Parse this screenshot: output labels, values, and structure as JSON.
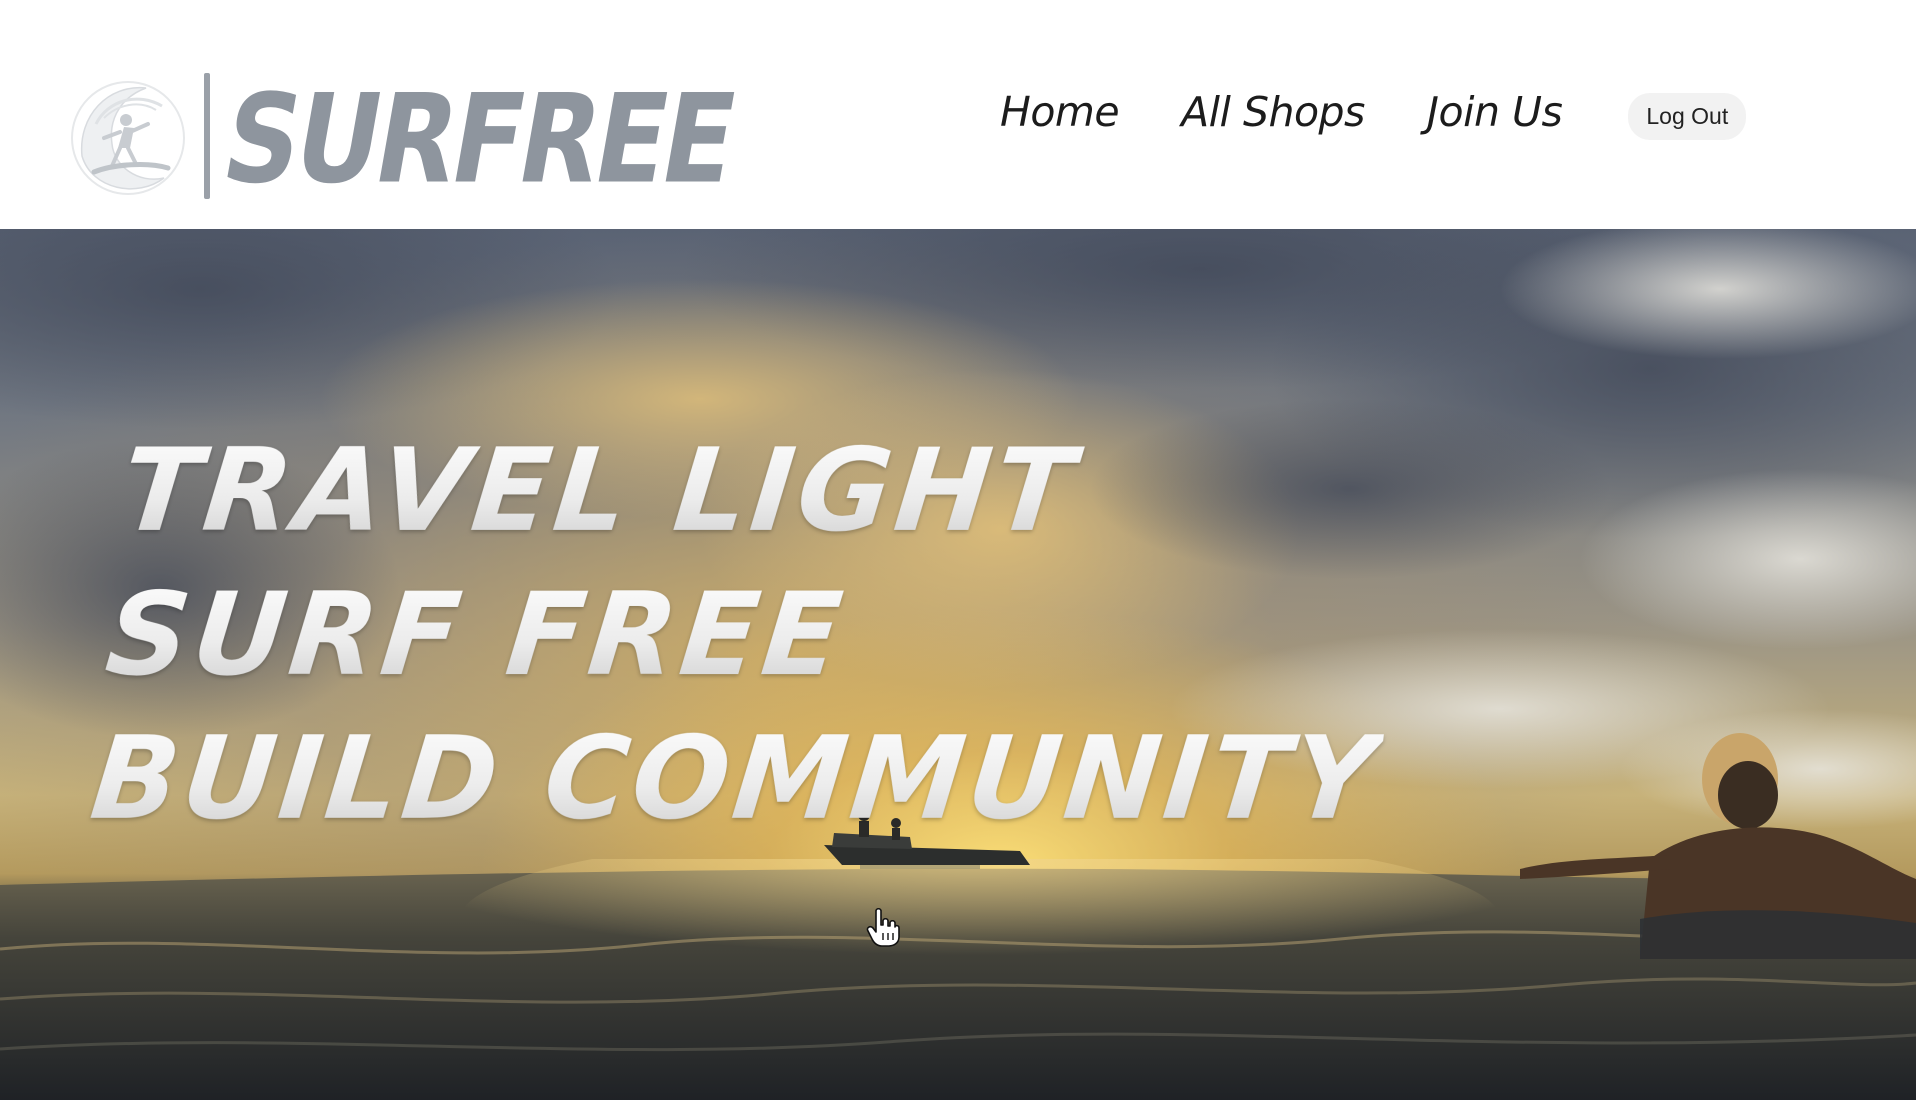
{
  "brand": {
    "name": "SURFREE",
    "logo_icon": "surfer-wave-emblem"
  },
  "nav": {
    "items": [
      {
        "label": "Home"
      },
      {
        "label": "All Shops"
      },
      {
        "label": "Join Us"
      }
    ],
    "logout_label": "Log Out"
  },
  "hero": {
    "headline": [
      "TRAVEL LIGHT",
      "SURF FREE",
      "BUILD COMMUNITY"
    ],
    "scene": "sunset-ocean-video"
  },
  "colors": {
    "logo_gray": "#8e959e",
    "nav_text": "#1c1c1c",
    "logout_bg": "#f2f2f2",
    "headline_text": "#f4f4f4"
  }
}
